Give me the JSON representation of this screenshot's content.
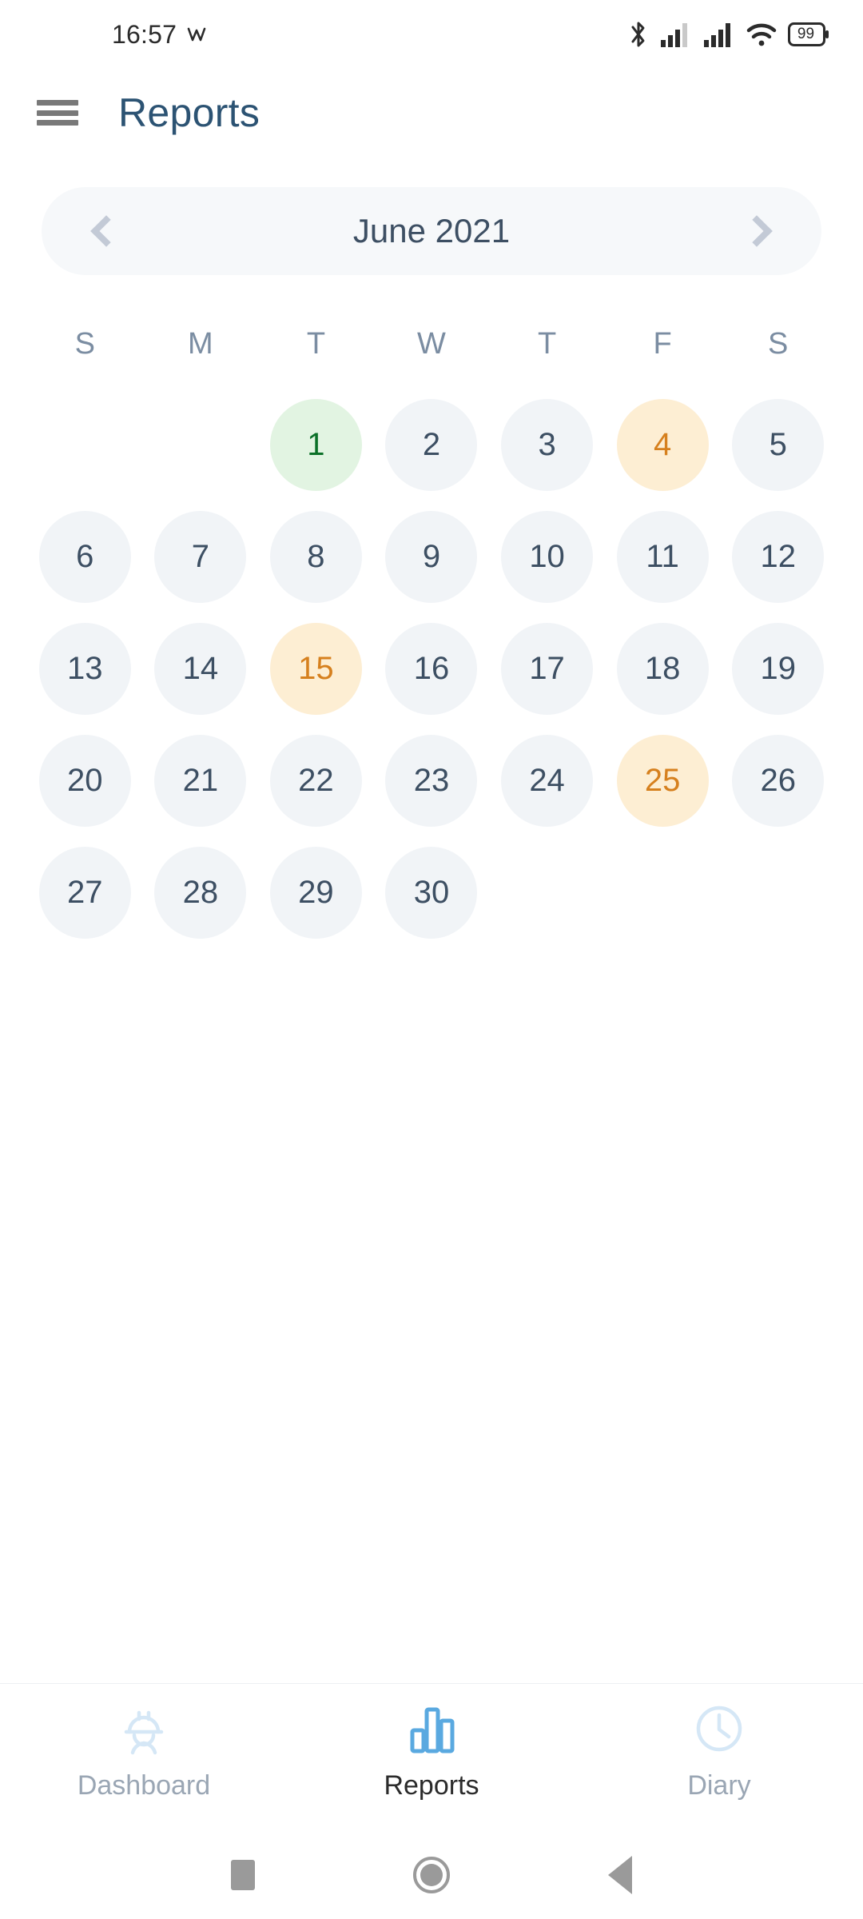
{
  "status_bar": {
    "time": "16:57",
    "notification_icon": "vpn-icon",
    "icons": [
      "bluetooth-icon",
      "signal-1-icon",
      "signal-2-icon",
      "wifi-icon"
    ],
    "battery_level": "99"
  },
  "header": {
    "menu_icon": "hamburger-menu-icon",
    "title": "Reports"
  },
  "month_nav": {
    "prev_icon": "chevron-left-icon",
    "next_icon": "chevron-right-icon",
    "label": "June 2021"
  },
  "calendar": {
    "weekdays": [
      "S",
      "M",
      "T",
      "W",
      "T",
      "F",
      "S"
    ],
    "weeks": [
      [
        {
          "label": "",
          "state": "empty"
        },
        {
          "label": "",
          "state": "empty"
        },
        {
          "label": "1",
          "state": "green"
        },
        {
          "label": "2",
          "state": "plain"
        },
        {
          "label": "3",
          "state": "plain"
        },
        {
          "label": "4",
          "state": "orange"
        },
        {
          "label": "5",
          "state": "plain"
        }
      ],
      [
        {
          "label": "6",
          "state": "plain"
        },
        {
          "label": "7",
          "state": "plain"
        },
        {
          "label": "8",
          "state": "plain"
        },
        {
          "label": "9",
          "state": "plain"
        },
        {
          "label": "10",
          "state": "plain"
        },
        {
          "label": "11",
          "state": "plain"
        },
        {
          "label": "12",
          "state": "plain"
        }
      ],
      [
        {
          "label": "13",
          "state": "plain"
        },
        {
          "label": "14",
          "state": "plain"
        },
        {
          "label": "15",
          "state": "orange"
        },
        {
          "label": "16",
          "state": "plain"
        },
        {
          "label": "17",
          "state": "plain"
        },
        {
          "label": "18",
          "state": "plain"
        },
        {
          "label": "19",
          "state": "plain"
        }
      ],
      [
        {
          "label": "20",
          "state": "plain"
        },
        {
          "label": "21",
          "state": "plain"
        },
        {
          "label": "22",
          "state": "plain"
        },
        {
          "label": "23",
          "state": "plain"
        },
        {
          "label": "24",
          "state": "plain"
        },
        {
          "label": "25",
          "state": "orange"
        },
        {
          "label": "26",
          "state": "plain"
        }
      ],
      [
        {
          "label": "27",
          "state": "plain"
        },
        {
          "label": "28",
          "state": "plain"
        },
        {
          "label": "29",
          "state": "plain"
        },
        {
          "label": "30",
          "state": "plain"
        },
        {
          "label": "",
          "state": "empty"
        },
        {
          "label": "",
          "state": "empty"
        },
        {
          "label": "",
          "state": "empty"
        }
      ]
    ]
  },
  "tab_bar": {
    "tabs": [
      {
        "label": "Dashboard",
        "icon": "hard-hat-worker-icon",
        "active": false
      },
      {
        "label": "Reports",
        "icon": "bar-chart-icon",
        "active": true
      },
      {
        "label": "Diary",
        "icon": "clock-icon",
        "active": false
      }
    ]
  },
  "android_nav": {
    "recents_icon": "square-recents-icon",
    "home_icon": "circle-home-icon",
    "back_icon": "triangle-back-icon"
  },
  "colors": {
    "title_blue": "#2c5373",
    "day_green_bg": "#e2f4e2",
    "day_green_text": "#0b7028",
    "day_orange_bg": "#fdeed3",
    "day_orange_text": "#d6801e",
    "day_plain_bg": "#f1f4f7",
    "day_plain_text": "#3d4f63",
    "tab_active_icon": "#5aa9e0",
    "tab_inactive_icon": "#d5e7f6"
  }
}
